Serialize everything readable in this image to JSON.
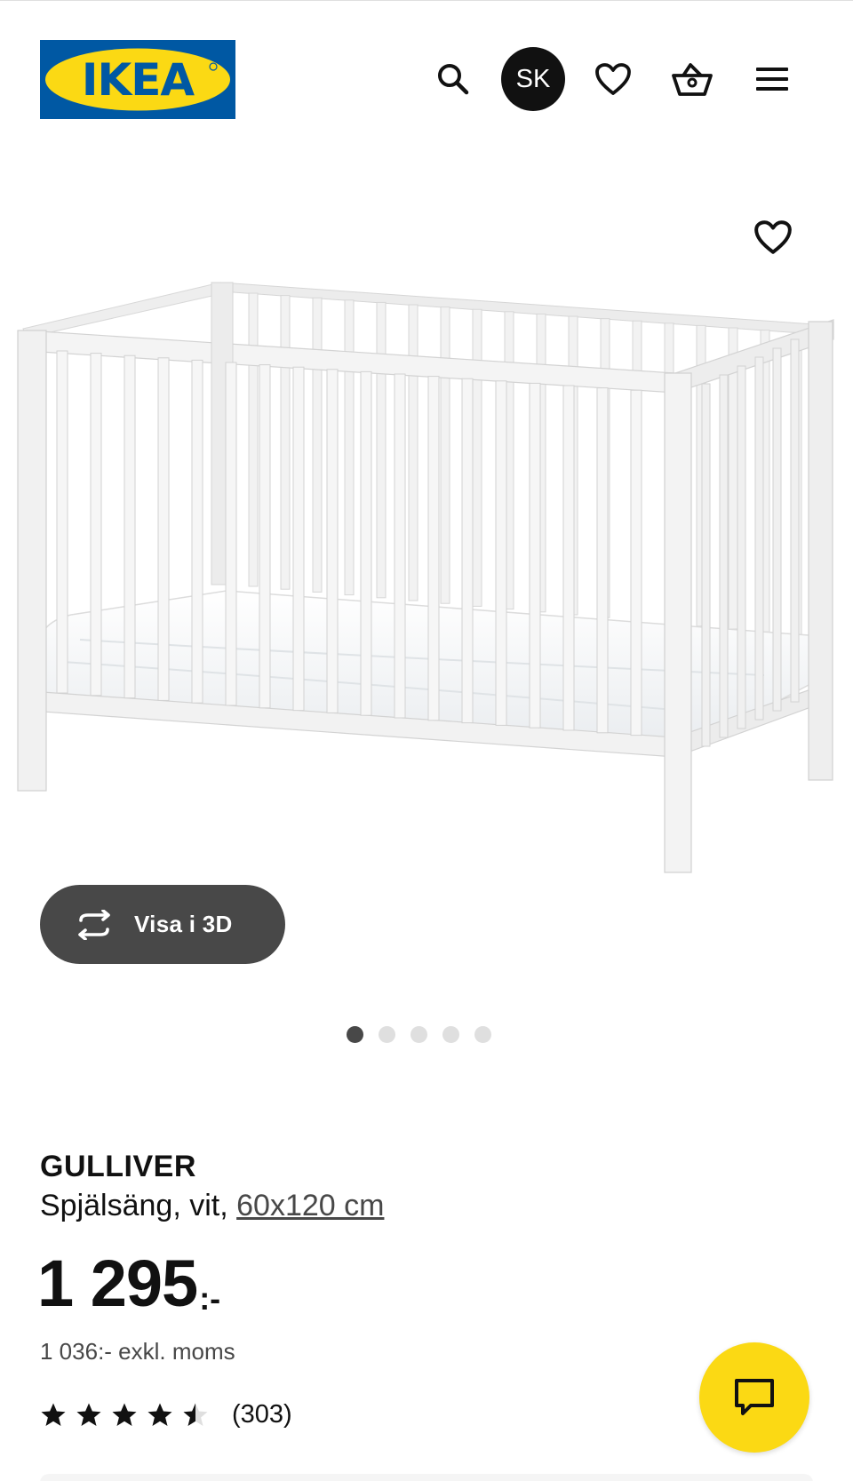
{
  "header": {
    "logo_text": "IKEA",
    "user_initials": "SK",
    "icons": [
      "search-icon",
      "heart-icon",
      "shopping-basket-icon",
      "hamburger-menu-icon"
    ]
  },
  "product_image": {
    "favourite_icon": "heart-icon",
    "view_3d_label": "Visa i 3D",
    "view_3d_icon": "rotate-3d-icon",
    "carousel": {
      "total": 5,
      "active": 1
    }
  },
  "product": {
    "name": "GULLIVER",
    "description": "Spjälsäng, vit,",
    "size_link": "60x120 cm",
    "price": "1 295",
    "price_suffix": ":-",
    "price_ex_vat": "1 036:- exkl. moms",
    "rating_value": 4.5,
    "rating_max": 5,
    "rating_count": "(303)"
  },
  "chat": {
    "icon": "chat-bubble-icon"
  },
  "colors": {
    "brand_blue": "#0058a3",
    "brand_yellow": "#fbd914",
    "dark_grey": "#484848",
    "text": "#111111"
  }
}
